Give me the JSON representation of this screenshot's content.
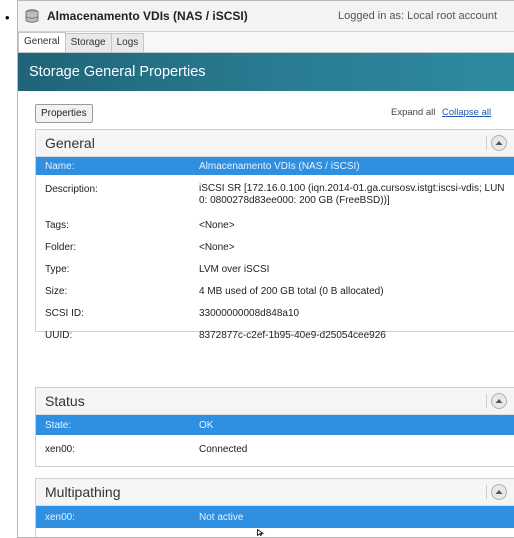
{
  "window": {
    "title": "Almacenamento VDIs (NAS / iSCSI)",
    "login_status": "Logged in as: Local root account"
  },
  "tabs": [
    {
      "label": "General",
      "active": true
    },
    {
      "label": "Storage",
      "active": false
    },
    {
      "label": "Logs",
      "active": false
    }
  ],
  "banner": {
    "title": "Storage General Properties"
  },
  "toolbar": {
    "properties_label": "Properties",
    "expand_label": "Expand all",
    "collapse_label": "Collapse all"
  },
  "sections": {
    "general": {
      "title": "General",
      "rows": [
        {
          "label": "Name:",
          "value": "Almacenamento VDIs (NAS / iSCSI)",
          "selected": true
        },
        {
          "label": "Description:",
          "value": "iSCSI SR [172.16.0.100 (iqn.2014-01.ga.cursosv.istgt:iscsi-vdis; LUN 0: 0800278d83ee000: 200 GB (FreeBSD))]",
          "selected": false
        },
        {
          "label": "Tags:",
          "value": "<None>",
          "selected": false
        },
        {
          "label": "Folder:",
          "value": "<None>",
          "selected": false
        },
        {
          "label": "Type:",
          "value": "LVM over iSCSI",
          "selected": false
        },
        {
          "label": "Size:",
          "value": "4 MB used of 200 GB total (0 B allocated)",
          "selected": false
        },
        {
          "label": "SCSI ID:",
          "value": "33000000008d848a10",
          "selected": false
        },
        {
          "label": "UUID:",
          "value": "8372877c-c2ef-1b95-40e9-d25054cee926",
          "selected": false
        }
      ]
    },
    "status": {
      "title": "Status",
      "rows": [
        {
          "label": "State:",
          "value": "OK",
          "selected": true
        },
        {
          "label": "xen00:",
          "value": "Connected",
          "selected": false
        }
      ]
    },
    "multipathing": {
      "title": "Multipathing",
      "rows": [
        {
          "label": "xen00:",
          "value": "Not active",
          "selected": true
        }
      ]
    }
  },
  "colors": {
    "banner": "#1f6478",
    "selected_row": "#2f8fe0",
    "link": "#1e56b0"
  },
  "icons": [
    "storage-icon",
    "collapse-section-icon",
    "mouse-pointer-icon"
  ]
}
